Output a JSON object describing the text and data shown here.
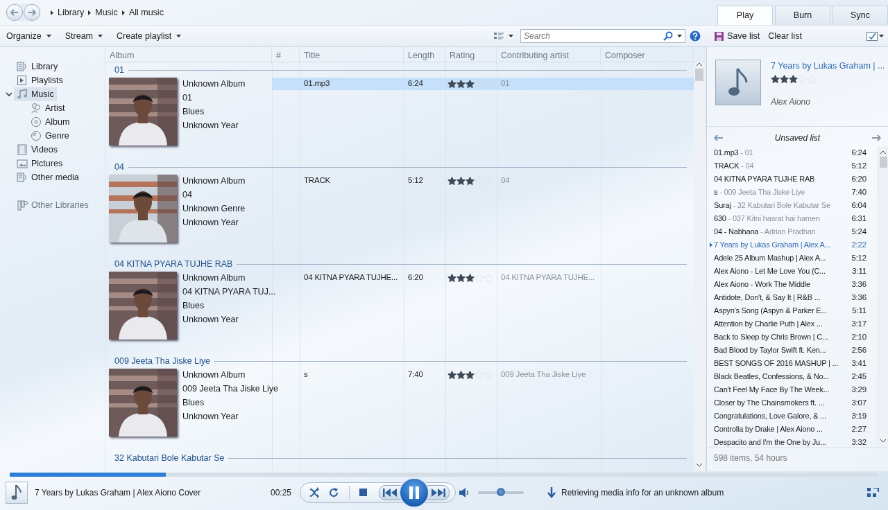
{
  "nav": {
    "breadcrumb": [
      "Library",
      "Music",
      "All music"
    ]
  },
  "tabs": [
    {
      "label": "Play",
      "selected": true
    },
    {
      "label": "Burn",
      "selected": false
    },
    {
      "label": "Sync",
      "selected": false
    }
  ],
  "toolbar": {
    "menus": [
      "Organize",
      "Stream",
      "Create playlist"
    ],
    "search": {
      "placeholder": "Search"
    }
  },
  "list_toolbar": {
    "buttons": [
      "Save list",
      "Clear list"
    ]
  },
  "sidebar": {
    "items": [
      {
        "label": "Library",
        "selected": false
      },
      {
        "label": "Playlists",
        "selected": false
      },
      {
        "label": "Music",
        "selected": true,
        "expanded": true,
        "children": [
          {
            "label": "Artist",
            "selected": false
          },
          {
            "label": "Album",
            "selected": false
          },
          {
            "label": "Genre",
            "selected": false
          }
        ]
      },
      {
        "label": "Videos",
        "selected": false
      },
      {
        "label": "Pictures",
        "selected": false
      },
      {
        "label": "Other media",
        "selected": false
      }
    ],
    "other_libraries": "Other Libraries"
  },
  "table": {
    "columns": [
      "Album",
      "#",
      "Title",
      "Length",
      "Rating",
      "Contributing artist",
      "Composer"
    ],
    "groups": [
      {
        "header": "01",
        "album_lines": [
          "Unknown Album",
          "01",
          "Blues",
          "Unknown Year"
        ],
        "rows": [
          {
            "title": "01.mp3",
            "length": "6:24",
            "stars": 3,
            "artist": "01",
            "selected": true
          }
        ]
      },
      {
        "header": "04",
        "album_lines": [
          "Unknown Album",
          "04",
          "Unknown Genre",
          "Unknown Year"
        ],
        "rows": [
          {
            "title": "TRACK",
            "length": "5:12",
            "stars": 3,
            "artist": "04",
            "selected": false
          }
        ]
      },
      {
        "header": "04 KITNA PYARA TUJHE RAB",
        "album_lines": [
          "Unknown Album",
          "04 KITNA PYARA TUJ...",
          "Blues",
          "Unknown Year"
        ],
        "rows": [
          {
            "title": "04 KITNA PYARA TUJHE...",
            "length": "6:20",
            "stars": 3,
            "artist": "04 KITNA PYARA TUJHE...",
            "selected": false
          }
        ]
      },
      {
        "header": "009 Jeeta Tha Jiske Liye",
        "album_lines": [
          "Unknown Album",
          "009 Jeeta Tha Jiske Liye",
          "Blues",
          "Unknown Year"
        ],
        "rows": [
          {
            "title": "s",
            "length": "7:40",
            "stars": 3,
            "artist": "009 Jeeta Tha Jiske Liye",
            "selected": false
          }
        ]
      },
      {
        "header": "32 Kabutari Bole Kabutar Se"
      }
    ]
  },
  "now_playing": {
    "title": "7 Years by Lukas Graham | ...",
    "stars": 3,
    "artist": "Alex Aiono"
  },
  "playlist": {
    "title": "Unsaved list",
    "items": [
      {
        "title": "01.mp3",
        "detail": "- 01",
        "length": "6:24",
        "playing": false
      },
      {
        "title": "TRACK",
        "detail": "- 04",
        "length": "5:12",
        "playing": false
      },
      {
        "title": "04 KITNA PYARA TUJHE RAB",
        "length": "6:20",
        "playing": false
      },
      {
        "title": "s",
        "detail": "- 009 Jeeta Tha Jiske Liye",
        "length": "7:40",
        "playing": false
      },
      {
        "title": "Suraj",
        "detail": "- 32 Kabutari Bole Kabutar Se",
        "length": "6:04",
        "playing": false
      },
      {
        "title": "630",
        "detail": "- 037 Kitni hasrat hai hamen",
        "length": "6:31",
        "playing": false
      },
      {
        "title": "04 - Nabhana",
        "detail": "- Adrian Pradhan",
        "length": "5:24",
        "playing": false
      },
      {
        "title": "7 Years by Lukas Graham | Alex A...",
        "length": "2:22",
        "playing": true
      },
      {
        "title": "Adele 25 Album Mashup | Alex A...",
        "length": "5:12",
        "playing": false
      },
      {
        "title": "Alex Aiono - Let Me Love You (C...",
        "length": "3:11",
        "playing": false
      },
      {
        "title": "Alex Aiono - Work The Middle",
        "length": "3:36",
        "playing": false
      },
      {
        "title": "Antidote, Don't, & Say It | R&B ...",
        "length": "3:36",
        "playing": false
      },
      {
        "title": "Aspyn's Song (Aspyn & Parker E...",
        "length": "5:11",
        "playing": false
      },
      {
        "title": "Attention by Charlie Puth | Alex ...",
        "length": "3:17",
        "playing": false
      },
      {
        "title": "Back to Sleep by Chris Brown | C...",
        "length": "2:10",
        "playing": false
      },
      {
        "title": "Bad Blood by Taylor Swift ft. Ken...",
        "length": "2:56",
        "playing": false
      },
      {
        "title": "BEST SONGS OF 2016 MASHUP | ...",
        "length": "3:41",
        "playing": false
      },
      {
        "title": "Black Beatles, Confessions, & No...",
        "length": "2:45",
        "playing": false
      },
      {
        "title": "Can't Feel My Face By The Week...",
        "length": "3:29",
        "playing": false
      },
      {
        "title": "Closer by The Chainsmokers ft. ...",
        "length": "3:07",
        "playing": false
      },
      {
        "title": "Congratulations, Love Galore, & ...",
        "length": "3:19",
        "playing": false
      },
      {
        "title": "Controlla by Drake | Alex Aiono ...",
        "length": "2:27",
        "playing": false
      },
      {
        "title": "Despacito and I'm the One by Ju...",
        "length": "3:32",
        "playing": false
      }
    ],
    "summary": "598 items, 54 hours"
  },
  "player": {
    "title": "7 Years by Lukas Graham | Alex Aiono Cover",
    "elapsed": "00:25",
    "progress": {
      "level": 0.18
    },
    "playing": true,
    "volume": {
      "level": 0.5
    },
    "status": "Retrieving media info for an unknown album"
  }
}
